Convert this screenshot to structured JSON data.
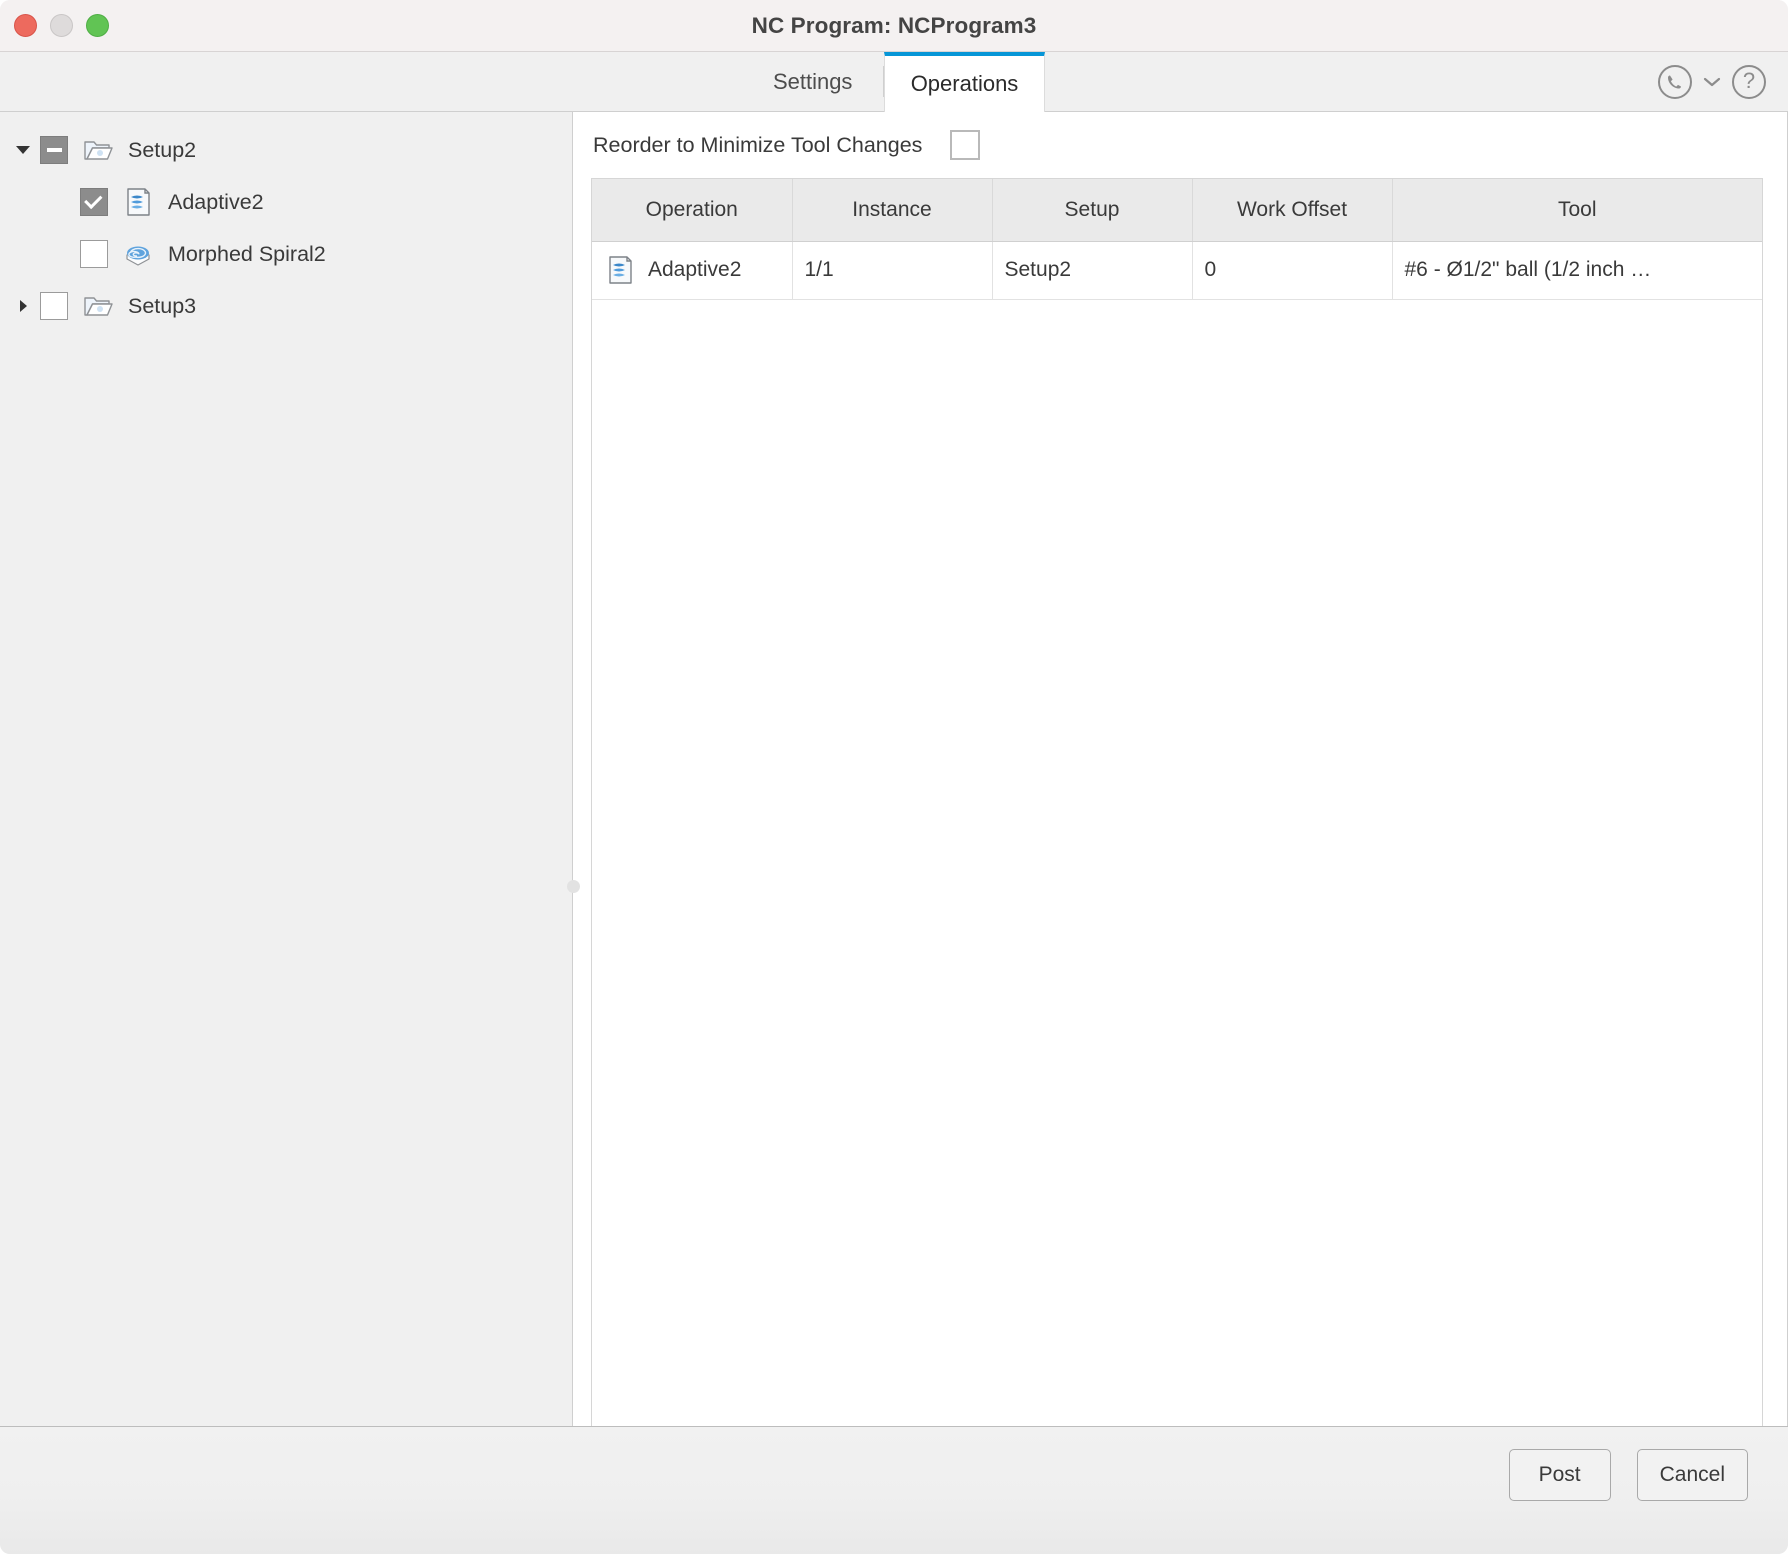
{
  "window": {
    "title": "NC Program: NCProgram3",
    "traffic_lights": [
      "close",
      "minimize",
      "maximize"
    ]
  },
  "tabs": [
    {
      "label": "Settings",
      "active": false
    },
    {
      "label": "Operations",
      "active": true
    }
  ],
  "toolbar_icons": {
    "support_phone": "phone-in-circle-icon",
    "dropdown": "chevron-down-icon",
    "help": "help-question-icon"
  },
  "tree": {
    "items": [
      {
        "label": "Setup2",
        "indent": 0,
        "twisty": "open",
        "checkbox": "partial",
        "icon": "folder-open-icon"
      },
      {
        "label": "Adaptive2",
        "indent": 1,
        "twisty": "blank",
        "checkbox": "checked",
        "icon": "adaptive-toolpath-icon"
      },
      {
        "label": "Morphed Spiral2",
        "indent": 1,
        "twisty": "blank",
        "checkbox": "unchecked",
        "icon": "morphed-spiral-icon"
      },
      {
        "label": "Setup3",
        "indent": 0,
        "twisty": "closed",
        "checkbox": "unchecked",
        "icon": "folder-open-icon"
      }
    ]
  },
  "reorder": {
    "label": "Reorder to Minimize Tool Changes",
    "checked": false
  },
  "table": {
    "columns": [
      "Operation",
      "Instance",
      "Setup",
      "Work Offset",
      "Tool"
    ],
    "rows": [
      {
        "operation": "Adaptive2",
        "operation_icon": "adaptive-toolpath-icon",
        "instance": "1/1",
        "setup": "Setup2",
        "work_offset": "0",
        "tool": "#6 - Ø1/2\" ball (1/2 inch …"
      }
    ]
  },
  "footer": {
    "post_label": "Post",
    "cancel_label": "Cancel"
  },
  "colors": {
    "accent": "#0696d7",
    "titlebar_bg": "#f4f1f1",
    "panel_bg": "#f0f0f0",
    "table_header_bg": "#eaeaea",
    "traffic_red": "#ed6a5e",
    "traffic_yellow": "#dedbdb",
    "traffic_green": "#61c454"
  }
}
